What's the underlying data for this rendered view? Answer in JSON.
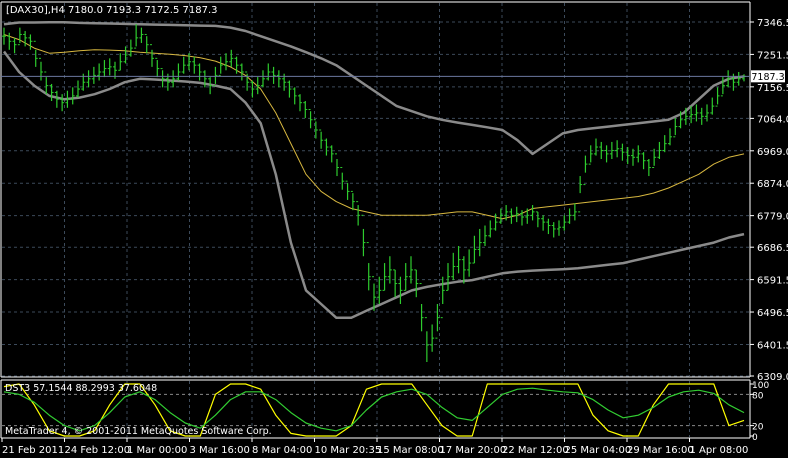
{
  "colors": {
    "background": "#000000",
    "grid": "#3c4a5a",
    "text": "#ffffff",
    "candle": "#2ecc2e",
    "band_outer": "#8a8a8a",
    "band_inner": "#d8b840",
    "price_line": "#6c78a0",
    "price_tag_bg": "#ffffff",
    "osc_main": "#ffff00",
    "osc_signal": "#32cd32",
    "osc_level": "#888888"
  },
  "main_chart": {
    "title": "[DAX30],H4  7180.0 7193.3 7172.5 7187.3",
    "current_price_label": "7187.3",
    "y_tick_labels": [
      "7346.5",
      "7251.5",
      "7156.5",
      "7064.0",
      "6969.0",
      "6874.0",
      "6779.0",
      "6686.5",
      "6591.5",
      "6496.5",
      "6401.5",
      "6309.0"
    ],
    "x_tick_labels": [
      "21 Feb 2011",
      "24 Feb 12:00",
      "1 Mar 00:00",
      "3 Mar 16:00",
      "8 Mar 04:00",
      "10 Mar 20:35",
      "15 Mar 08:00",
      "17 Mar 20:00",
      "22 Mar 12:00",
      "25 Mar 04:00",
      "29 Mar 16:00",
      "1 Apr 08:00"
    ]
  },
  "oscillator": {
    "title": "DST3 57.1544 88.2993 37.6048",
    "y_tick_labels": [
      "100",
      "80",
      "20",
      "0"
    ],
    "copyright": "MetaTrader 4, © 2001-2011 MetaQuotes Software Corp."
  },
  "chart_data": [
    {
      "type": "candlestick",
      "title": "[DAX30],H4  7180.0 7193.3 7172.5 7187.3",
      "ylim": [
        6309.0,
        7346.5
      ],
      "last_close": 7187.3,
      "x_tick_labels": [
        "21 Feb 2011",
        "24 Feb 12:00",
        "1 Mar 00:00",
        "3 Mar 16:00",
        "8 Mar 04:00",
        "10 Mar 20:35",
        "15 Mar 08:00",
        "17 Mar 20:00",
        "22 Mar 12:00",
        "25 Mar 04:00",
        "29 Mar 16:00",
        "1 Apr 08:00"
      ],
      "y_ticks": [
        7346.5,
        7251.5,
        7156.5,
        7064.0,
        6969.0,
        6874.0,
        6779.0,
        6686.5,
        6591.5,
        6496.5,
        6401.5,
        6309.0
      ],
      "close": [
        7305,
        7290,
        7280,
        7310,
        7300,
        7290,
        7240,
        7200,
        7160,
        7140,
        7120,
        7110,
        7120,
        7130,
        7150,
        7170,
        7180,
        7190,
        7200,
        7210,
        7215,
        7205,
        7230,
        7250,
        7270,
        7300,
        7310,
        7280,
        7240,
        7210,
        7180,
        7170,
        7180,
        7200,
        7220,
        7230,
        7220,
        7200,
        7180,
        7160,
        7190,
        7220,
        7230,
        7240,
        7220,
        7200,
        7170,
        7150,
        7160,
        7180,
        7200,
        7190,
        7180,
        7170,
        7150,
        7130,
        7110,
        7090,
        7060,
        7030,
        7000,
        6980,
        6960,
        6920,
        6880,
        6850,
        6820,
        6780,
        6700,
        6600,
        6540,
        6560,
        6600,
        6620,
        6580,
        6560,
        6600,
        6620,
        6580,
        6480,
        6400,
        6420,
        6480,
        6560,
        6600,
        6630,
        6650,
        6620,
        6640,
        6680,
        6700,
        6720,
        6740,
        6760,
        6780,
        6790,
        6780,
        6785,
        6775,
        6780,
        6790,
        6770,
        6760,
        6750,
        6740,
        6745,
        6760,
        6780,
        6790,
        6870,
        6930,
        6960,
        6980,
        6970,
        6960,
        6970,
        6975,
        6965,
        6955,
        6950,
        6960,
        6940,
        6920,
        6950,
        6970,
        6990,
        7010,
        7040,
        7060,
        7070,
        7075,
        7080,
        7070,
        7080,
        7100,
        7130,
        7160,
        7180,
        7170,
        7180,
        7187.3
      ],
      "high": [
        7330,
        7315,
        7300,
        7330,
        7320,
        7310,
        7265,
        7230,
        7185,
        7165,
        7145,
        7135,
        7145,
        7155,
        7175,
        7195,
        7205,
        7215,
        7225,
        7235,
        7240,
        7230,
        7255,
        7275,
        7295,
        7340,
        7330,
        7305,
        7265,
        7235,
        7205,
        7195,
        7205,
        7225,
        7245,
        7255,
        7245,
        7225,
        7205,
        7185,
        7215,
        7245,
        7255,
        7265,
        7245,
        7225,
        7195,
        7175,
        7185,
        7205,
        7225,
        7215,
        7205,
        7195,
        7175,
        7155,
        7135,
        7115,
        7085,
        7055,
        7025,
        7005,
        6985,
        6945,
        6905,
        6875,
        6845,
        6810,
        6740,
        6640,
        6580,
        6600,
        6640,
        6660,
        6620,
        6600,
        6640,
        6660,
        6620,
        6520,
        6440,
        6460,
        6520,
        6600,
        6640,
        6670,
        6690,
        6660,
        6680,
        6720,
        6740,
        6750,
        6765,
        6785,
        6800,
        6810,
        6800,
        6805,
        6795,
        6800,
        6810,
        6790,
        6780,
        6770,
        6760,
        6765,
        6780,
        6800,
        6815,
        6895,
        6955,
        6985,
        7005,
        6995,
        6985,
        6995,
        7000,
        6990,
        6980,
        6975,
        6985,
        6965,
        6945,
        6975,
        6995,
        7015,
        7035,
        7065,
        7085,
        7095,
        7100,
        7105,
        7095,
        7105,
        7125,
        7155,
        7185,
        7205,
        7195,
        7200,
        7193.3
      ],
      "low": [
        7280,
        7265,
        7255,
        7285,
        7275,
        7265,
        7215,
        7175,
        7135,
        7115,
        7095,
        7085,
        7095,
        7105,
        7125,
        7145,
        7155,
        7165,
        7175,
        7185,
        7190,
        7180,
        7205,
        7225,
        7245,
        7275,
        7285,
        7255,
        7215,
        7185,
        7155,
        7145,
        7155,
        7175,
        7195,
        7205,
        7195,
        7175,
        7155,
        7135,
        7165,
        7195,
        7205,
        7215,
        7195,
        7175,
        7145,
        7125,
        7135,
        7155,
        7175,
        7165,
        7155,
        7145,
        7125,
        7105,
        7085,
        7065,
        7035,
        7005,
        6975,
        6955,
        6935,
        6895,
        6855,
        6825,
        6795,
        6750,
        6660,
        6560,
        6500,
        6520,
        6560,
        6580,
        6540,
        6520,
        6560,
        6580,
        6540,
        6440,
        6350,
        6380,
        6440,
        6520,
        6560,
        6590,
        6610,
        6580,
        6600,
        6640,
        6660,
        6690,
        6715,
        6735,
        6755,
        6765,
        6755,
        6760,
        6750,
        6755,
        6765,
        6745,
        6735,
        6725,
        6715,
        6720,
        6735,
        6755,
        6765,
        6845,
        6905,
        6935,
        6955,
        6945,
        6935,
        6945,
        6950,
        6940,
        6930,
        6925,
        6935,
        6915,
        6895,
        6925,
        6945,
        6965,
        6985,
        7015,
        7035,
        7045,
        7050,
        7055,
        7045,
        7055,
        7075,
        7105,
        7135,
        7155,
        7145,
        7160,
        7172.5
      ],
      "series_bands": {
        "upper_band": [
          7340,
          7345,
          7345,
          7346,
          7346,
          7344,
          7343,
          7342,
          7341,
          7340,
          7339,
          7338,
          7337,
          7336,
          7335,
          7330,
          7320,
          7305,
          7290,
          7275,
          7258,
          7240,
          7220,
          7190,
          7160,
          7130,
          7100,
          7085,
          7070,
          7060,
          7052,
          7045,
          7038,
          7030,
          7000,
          6960,
          6990,
          7020,
          7030,
          7035,
          7040,
          7045,
          7050,
          7055,
          7060,
          7080,
          7120,
          7160,
          7180,
          7187
        ],
        "middle_band": [
          7310,
          7295,
          7270,
          7255,
          7258,
          7262,
          7265,
          7264,
          7262,
          7258,
          7255,
          7252,
          7248,
          7242,
          7232,
          7215,
          7190,
          7150,
          7080,
          6990,
          6900,
          6850,
          6820,
          6800,
          6790,
          6780,
          6780,
          6780,
          6780,
          6785,
          6790,
          6790,
          6780,
          6770,
          6780,
          6800,
          6805,
          6810,
          6815,
          6820,
          6825,
          6830,
          6835,
          6845,
          6860,
          6880,
          6900,
          6930,
          6950,
          6960
        ],
        "lower_band": [
          7260,
          7200,
          7160,
          7130,
          7120,
          7125,
          7135,
          7150,
          7170,
          7180,
          7178,
          7175,
          7172,
          7168,
          7160,
          7150,
          7110,
          7050,
          6900,
          6700,
          6560,
          6520,
          6480,
          6480,
          6500,
          6520,
          6540,
          6560,
          6570,
          6578,
          6585,
          6590,
          6600,
          6610,
          6615,
          6618,
          6620,
          6622,
          6625,
          6630,
          6635,
          6640,
          6650,
          6660,
          6670,
          6680,
          6690,
          6700,
          6715,
          6725
        ]
      }
    },
    {
      "type": "line",
      "title": "DST3 57.1544 88.2993 37.6048",
      "ylim": [
        0,
        100
      ],
      "y_ticks": [
        100,
        80,
        20,
        0
      ],
      "levels": [
        80,
        20
      ],
      "series": [
        {
          "values": [
            95,
            100,
            60,
            10,
            0,
            0,
            10,
            60,
            100,
            100,
            60,
            10,
            0,
            0,
            80,
            100,
            100,
            90,
            40,
            5,
            0,
            0,
            0,
            20,
            90,
            100,
            100,
            100,
            60,
            20,
            0,
            0,
            100,
            100,
            100,
            100,
            100,
            100,
            100,
            40,
            10,
            0,
            0,
            60,
            100,
            100,
            100,
            100,
            20,
            30
          ]
        },
        {
          "values": [
            85,
            80,
            65,
            40,
            20,
            10,
            20,
            45,
            75,
            85,
            70,
            45,
            25,
            15,
            40,
            70,
            85,
            85,
            70,
            45,
            25,
            15,
            10,
            20,
            50,
            75,
            85,
            90,
            80,
            55,
            35,
            30,
            55,
            80,
            90,
            92,
            88,
            85,
            83,
            70,
            50,
            35,
            40,
            55,
            75,
            85,
            88,
            82,
            60,
            45
          ]
        }
      ]
    }
  ]
}
